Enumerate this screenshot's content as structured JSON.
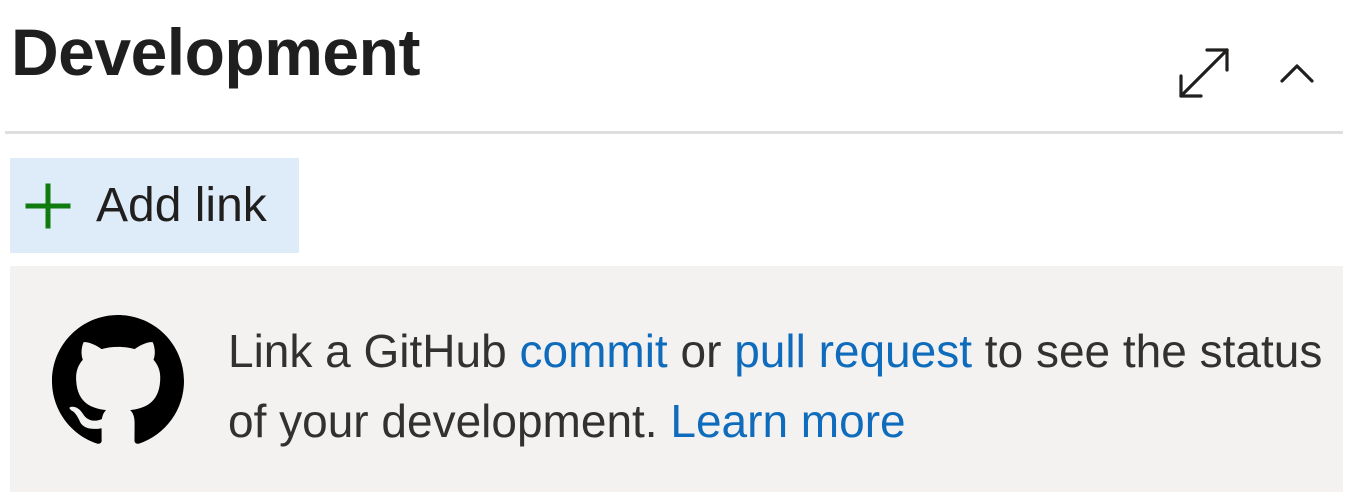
{
  "header": {
    "title": "Development"
  },
  "toolbar": {
    "add_link_label": "Add link"
  },
  "info": {
    "text_1": "Link a GitHub ",
    "link_commit": "commit",
    "text_2": " or ",
    "link_pull_request": "pull request",
    "text_3": " to see the status of your development. ",
    "link_learn_more": "Learn more"
  },
  "icons": {
    "expand": "expand-icon",
    "collapse": "chevron-up-icon",
    "add": "plus-icon",
    "github": "github-icon"
  },
  "colors": {
    "accent_link": "#0f6cbd",
    "add_green": "#107c10",
    "add_button_bg": "#deecf9",
    "info_bg": "#f3f2f1",
    "divider": "#e1dfdd"
  }
}
